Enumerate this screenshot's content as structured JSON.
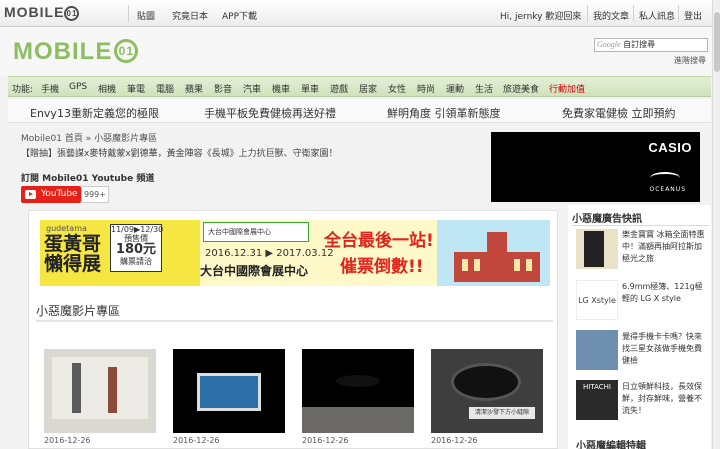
{
  "topbar": {
    "logo": "MOBILE01",
    "nav": [
      "貼圖",
      "究竟日本",
      "APP下載"
    ],
    "user_greeting": "Hi, jernky 歡迎回來",
    "user_links": [
      "我的文章",
      "私人訊息",
      "登出"
    ]
  },
  "header": {
    "logo": "MOBILE01",
    "search_placeholder": "自訂搜尋",
    "google_label": "Google",
    "advanced_search": "進階搜尋"
  },
  "navbar": {
    "label": "功能:",
    "items": [
      "手機",
      "GPS",
      "相機",
      "筆電",
      "電腦",
      "蘋果",
      "影音",
      "汽車",
      "機車",
      "單車",
      "遊戲",
      "居家",
      "女性",
      "時尚",
      "運動",
      "生活",
      "旅遊美食",
      "行動加值"
    ],
    "highlight_color": "#cc0000"
  },
  "promo": {
    "items": [
      "Envy13重新定義您的極限",
      "手機平板免費健檢再送好禮",
      "鮮明角度 引領革新態度",
      "免費家電健檢 立即預約"
    ]
  },
  "breadcrumb": "Mobile01 首頁 » 小惡魔影片專區",
  "headline": "【贈抽】張藝謀x麥特戴蒙x劉德華，黃金陣容《長城》上力抗巨獸、守衛家園！",
  "subscribe_label": "訂閱 Mobile01 Youtube 頻道",
  "youtube": {
    "label": "YouTube",
    "count": "999+"
  },
  "casio_ad": {
    "brand": "CASIO",
    "sub": "OCEANUS"
  },
  "banner": {
    "title_small": "gudetama",
    "title_big": "蛋黃哥懶得展",
    "dates": "11/09▶12/30",
    "price_label": "預售價",
    "price": "180元",
    "price_note": "購票請洽",
    "mid_box": "大台中國際會展中心",
    "mid_line1": "2016.12.31 ▶ 2017.03.12",
    "mid_line2": "大台中國際會展中心",
    "cta1": "全台最後一站!",
    "cta2": "催票倒數!!"
  },
  "section_title": "小惡魔影片專區",
  "videos": [
    {
      "date": "2016-12-26"
    },
    {
      "date": "2016-12-26"
    },
    {
      "date": "2016-12-26"
    },
    {
      "date": "2016-12-26",
      "caption": "清潔沙發下方小縫隙"
    }
  ],
  "sidebar": {
    "title": "小惡魔廣告快訊",
    "items": [
      "樂金寶寶 冰箱全面特惠中！滿額再抽阿拉斯加極光之旅",
      "6.9mm極簿、121g極輕的 LG X style",
      "覺得手機卡卡嗎？快來找三星女孩做手機免費健檢",
      "日立頓鮮科技，長效保鮮，封存鮮味，營養不流失！"
    ],
    "lg_brand": "LG Xstyle",
    "hitachi_brand": "HITACHI",
    "title2": "小惡魔編輯特輯"
  }
}
